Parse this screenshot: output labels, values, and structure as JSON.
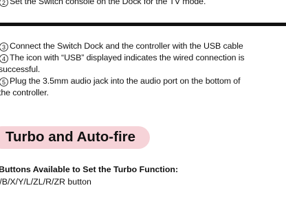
{
  "steps": {
    "s2": {
      "num": "2",
      "text": "Set the Switch console on the Dock for the TV mode."
    },
    "s3": {
      "num": "3",
      "text": "Connect the Switch Dock and the controller with the USB cable"
    },
    "s4": {
      "num": "4",
      "line1": "The icon with “USB” displayed indicates the wired connection is",
      "line2": "successful."
    },
    "s5": {
      "num": "5",
      "line1": "Plug the 3.5mm audio jack into the audio port on the bottom of",
      "line2": "the controller."
    }
  },
  "section": {
    "title": "Turbo and Auto-fire",
    "pill_color": "#f6d3d8"
  },
  "turbo": {
    "subheading": "Buttons Available to Set the Turbo Function:",
    "buttons": "A/B/X/Y/L/ZL/R/ZR button"
  }
}
